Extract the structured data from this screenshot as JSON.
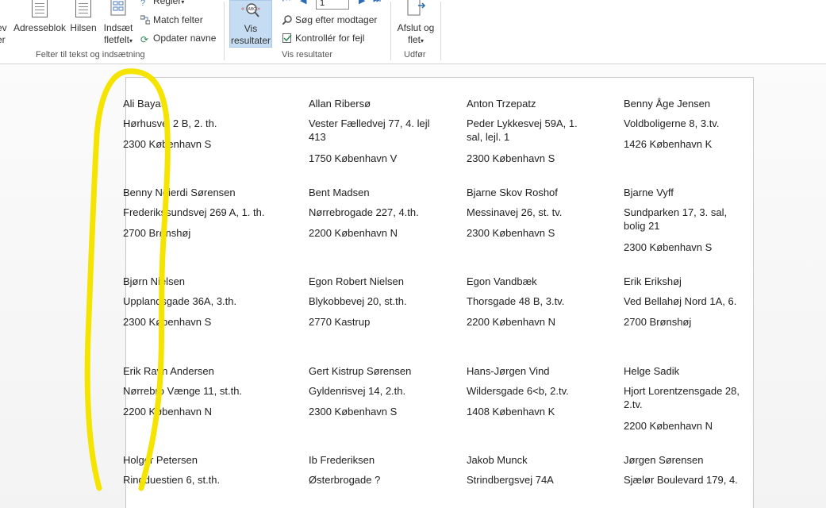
{
  "ribbon": {
    "group_insert_label": "Felter til tekst og indsætning",
    "group_preview_label": "Vis resultater",
    "group_finish_label": "Udfør",
    "btn_cut_partial": "ev\ner",
    "btn_address": "Adresseblok",
    "btn_greeting": "Hilsen",
    "btn_insert_field": "Indsæt\nfletfelt",
    "btn_rules": "Regler",
    "btn_match": "Match felter",
    "btn_update": "Opdater navne",
    "btn_preview": "Vis\nresultater",
    "btn_find": "Søg efter modtager",
    "btn_check": "Kontrollér for fejl",
    "btn_finish": "Afslut og\nflet",
    "record_value": "1",
    "accent_color": "#c5dcf2"
  },
  "labels": [
    {
      "name": "Ali Bayati",
      "street": "Hørhusvej 2 B, 2. th.",
      "city": "2300 København S"
    },
    {
      "name": "Allan Ribersø",
      "street": "Vester Fælledvej 77, 4. lejl 413",
      "city": "1750 København V"
    },
    {
      "name": "Anton Trzepatz",
      "street": "Peder Lykkesvej 59A, 1. sal, lejl. 1",
      "city": "2300 København S"
    },
    {
      "name": "Benny Åge Jensen",
      "street": "Voldboligerne 8, 3.tv.",
      "city": "1426 København K"
    },
    {
      "name": "Benny Neierdi Sørensen",
      "street": "Frederikssundsvej 269 A, 1. th.",
      "city": "2700 Brønshøj"
    },
    {
      "name": "Bent Madsen",
      "street": "Nørrebrogade 227, 4.th.",
      "city": "2200 København N"
    },
    {
      "name": "Bjarne Skov Roshof",
      "street": "Messinavej 26, st. tv.",
      "city": "2300 København S"
    },
    {
      "name": "Bjarne Vyff",
      "street": "Sundparken 17, 3. sal, bolig 21",
      "city": "2300 København S"
    },
    {
      "name": "Bjørn Nielsen",
      "street": "Upplandsgade 36A, 3.th.",
      "city": "2300 København S"
    },
    {
      "name": "Egon Robert Nielsen",
      "street": "Blykobbevej 20, st.th.",
      "city": "2770 Kastrup"
    },
    {
      "name": "Egon Vandbæk",
      "street": "Thorsgade 48 B, 3.tv.",
      "city": "2200 København N"
    },
    {
      "name": "Erik Erikshøj",
      "street": "Ved Bellahøj Nord 1A, 6.",
      "city": "2700 Brønshøj"
    },
    {
      "name": "Erik Ravn Andersen",
      "street": "Nørrebro Vænge 11, st.th.",
      "city": "2200 København N"
    },
    {
      "name": "Gert Kistrup Sørensen",
      "street": "Gyldenrisvej 14, 2.th.",
      "city": "2300 København S"
    },
    {
      "name": "Hans-Jørgen Vind",
      "street": "Wildersgade 6<b, 2.tv.",
      "city": "1408 København K"
    },
    {
      "name": "Helge Sadik",
      "street": "Hjort Lorentzensgade 28, 2.tv.",
      "city": "2200 København N"
    },
    {
      "name": "Holger Petersen",
      "street": "Ringduestien 6, st.th.",
      "city": ""
    },
    {
      "name": "Ib Frederiksen",
      "street": "Østerbrogade ?",
      "city": ""
    },
    {
      "name": "Jakob Munck",
      "street": "Strindbergsvej 74A",
      "city": ""
    },
    {
      "name": "Jørgen Sørensen",
      "street": "Sjælør Boulevard 179, 4.",
      "city": ""
    }
  ],
  "highlight_color": "#f5e400"
}
